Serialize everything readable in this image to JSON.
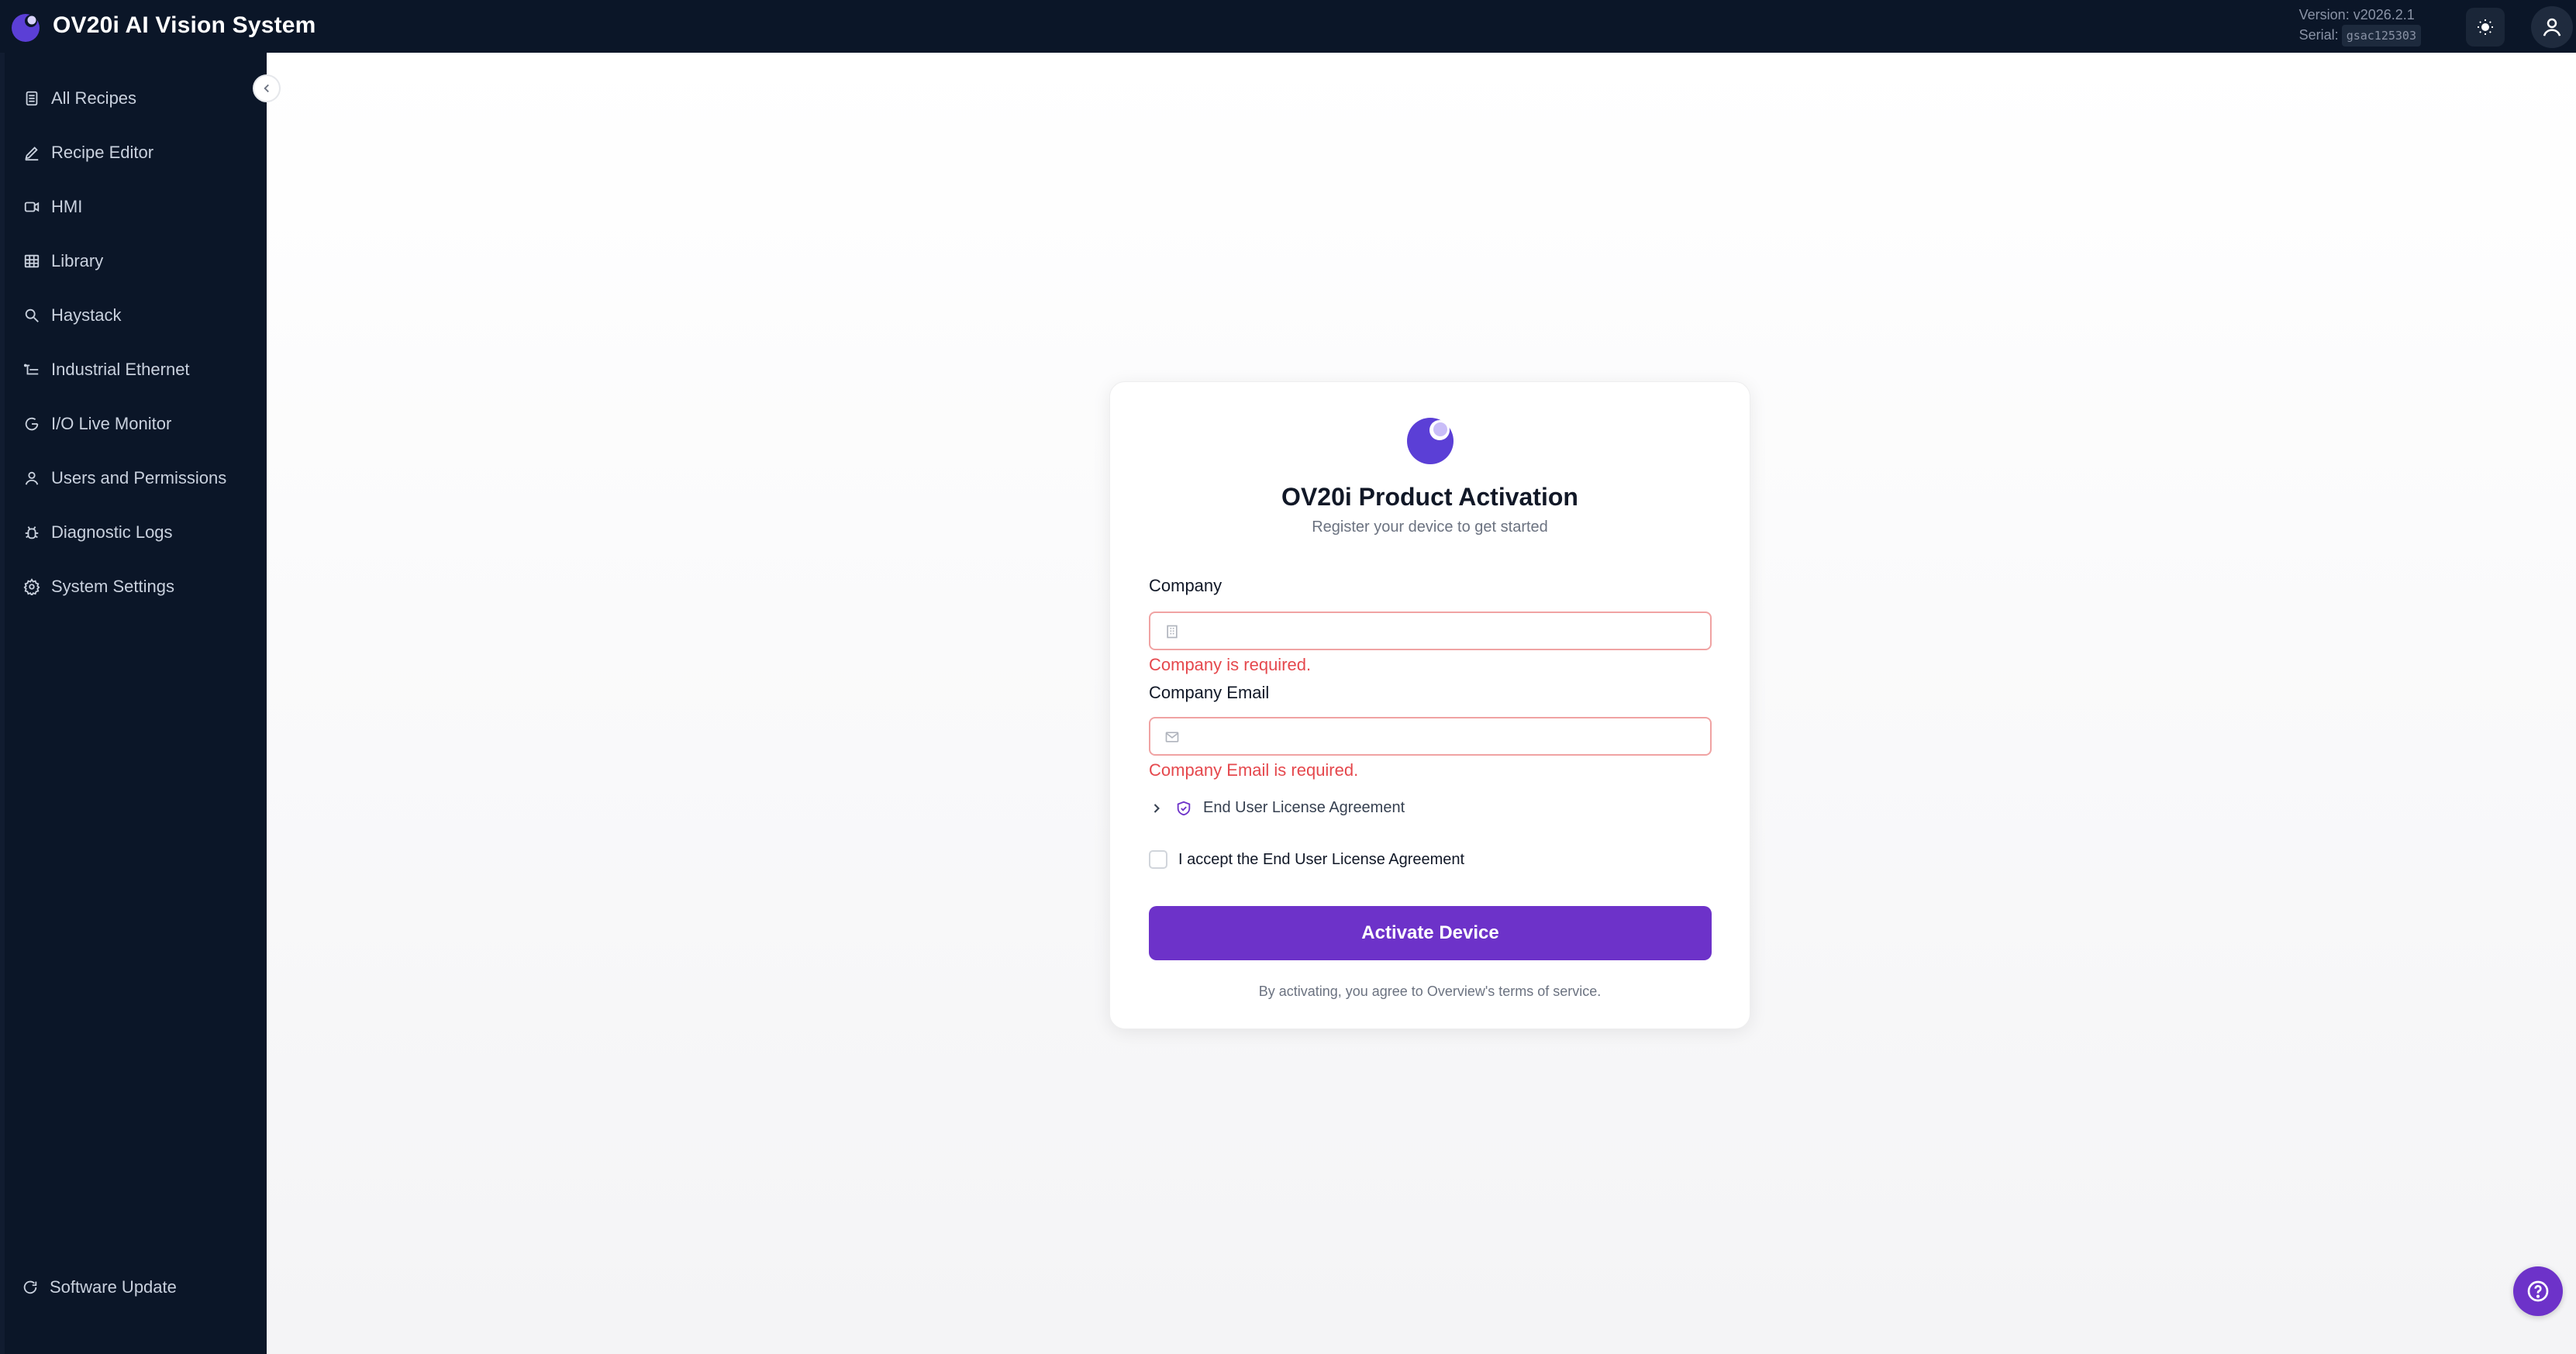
{
  "header": {
    "app_title": "OV20i AI Vision System",
    "version_label": "Version: v2026.2.1",
    "serial_label": "Serial:",
    "serial_value": "gsac125303"
  },
  "sidebar": {
    "items": [
      {
        "label": "All Recipes",
        "icon": "list-icon"
      },
      {
        "label": "Recipe Editor",
        "icon": "pencil-icon"
      },
      {
        "label": "HMI",
        "icon": "video-icon"
      },
      {
        "label": "Library",
        "icon": "grid-icon"
      },
      {
        "label": "Haystack",
        "icon": "search-icon"
      },
      {
        "label": "Industrial Ethernet",
        "icon": "network-icon"
      },
      {
        "label": "I/O Live Monitor",
        "icon": "gauge-icon"
      },
      {
        "label": "Users and Permissions",
        "icon": "user-icon"
      },
      {
        "label": "Diagnostic Logs",
        "icon": "bug-icon"
      },
      {
        "label": "System Settings",
        "icon": "gear-icon"
      }
    ],
    "software_update_label": "Software Update"
  },
  "activation": {
    "title": "OV20i Product Activation",
    "subtitle": "Register your device to get started",
    "company_label": "Company",
    "company_value": "",
    "company_error": "Company is required.",
    "email_label": "Company Email",
    "email_value": "",
    "email_error": "Company Email is required.",
    "eula_toggle_label": "End User License Agreement",
    "accept_label": "I accept the End User License Agreement",
    "accept_checked": false,
    "activate_button": "Activate Device",
    "terms_text": "By activating, you agree to Overview's terms of service."
  },
  "colors": {
    "accent": "#6d32c9",
    "sidebar_bg": "#0b1628",
    "error": "#e5484d"
  }
}
